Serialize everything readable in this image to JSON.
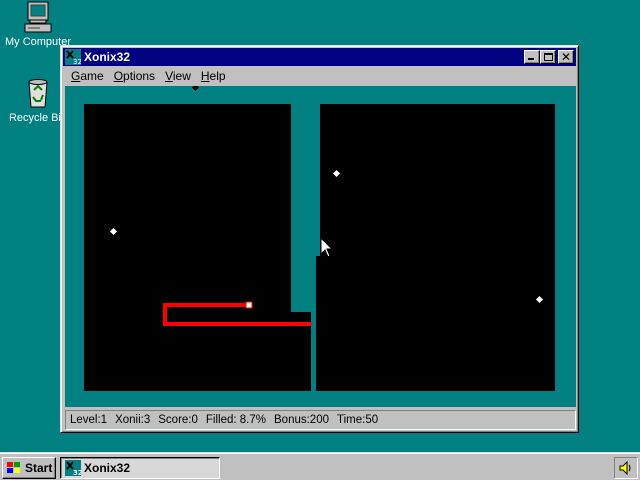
{
  "desktop": {
    "icons": [
      {
        "label": "My Computer",
        "icon": "computer-icon"
      },
      {
        "label": "Recycle Bin",
        "icon": "recycle-bin-icon"
      }
    ],
    "background_color": "#008080"
  },
  "window": {
    "title": "Xonix32",
    "icon": "xonix-app-icon",
    "menu": [
      {
        "label": "Game",
        "accel": "G",
        "rest": "ame"
      },
      {
        "label": "Options",
        "accel": "O",
        "rest": "ptions"
      },
      {
        "label": "View",
        "accel": "V",
        "rest": "iew"
      },
      {
        "label": "Help",
        "accel": "H",
        "rest": "elp"
      }
    ]
  },
  "game": {
    "field_color": "#000000",
    "filled_color": "#008080",
    "trail_color": "#ff0000",
    "ball_color": "#ffffff"
  },
  "status": {
    "level": "Level:1",
    "xonii": "Xonii:3",
    "score": "Score:0",
    "filled": "Filled: 8.7%",
    "bonus": "Bonus:200",
    "time": "Time:50"
  },
  "taskbar": {
    "start_label": "Start",
    "task_label": "Xonix32",
    "tray_icon": "speaker-icon"
  }
}
